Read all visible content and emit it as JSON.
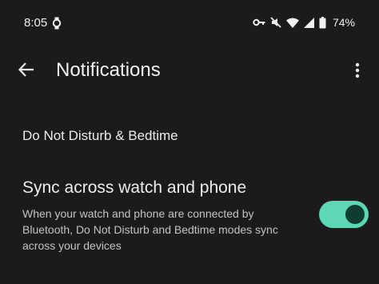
{
  "status_bar": {
    "time": "8:05",
    "battery": "74%",
    "icons": [
      "watch-icon",
      "key-icon",
      "mute-icon",
      "wifi-icon",
      "signal-icon",
      "battery-icon"
    ]
  },
  "app_bar": {
    "title": "Notifications",
    "back_icon": "arrow-back-icon",
    "more_icon": "more-vert-icon"
  },
  "settings": {
    "dnd_bedtime_label": "Do Not Disturb & Bedtime",
    "sync": {
      "title": "Sync across watch and phone",
      "description": "When your watch and phone are connected by Bluetooth, Do Not Disturb and Bedtime modes sync across your devices",
      "enabled": true
    }
  },
  "colors": {
    "background": "#1b1b1b",
    "toggle_track": "#5cd6b4",
    "toggle_knob": "#0f3c33"
  }
}
